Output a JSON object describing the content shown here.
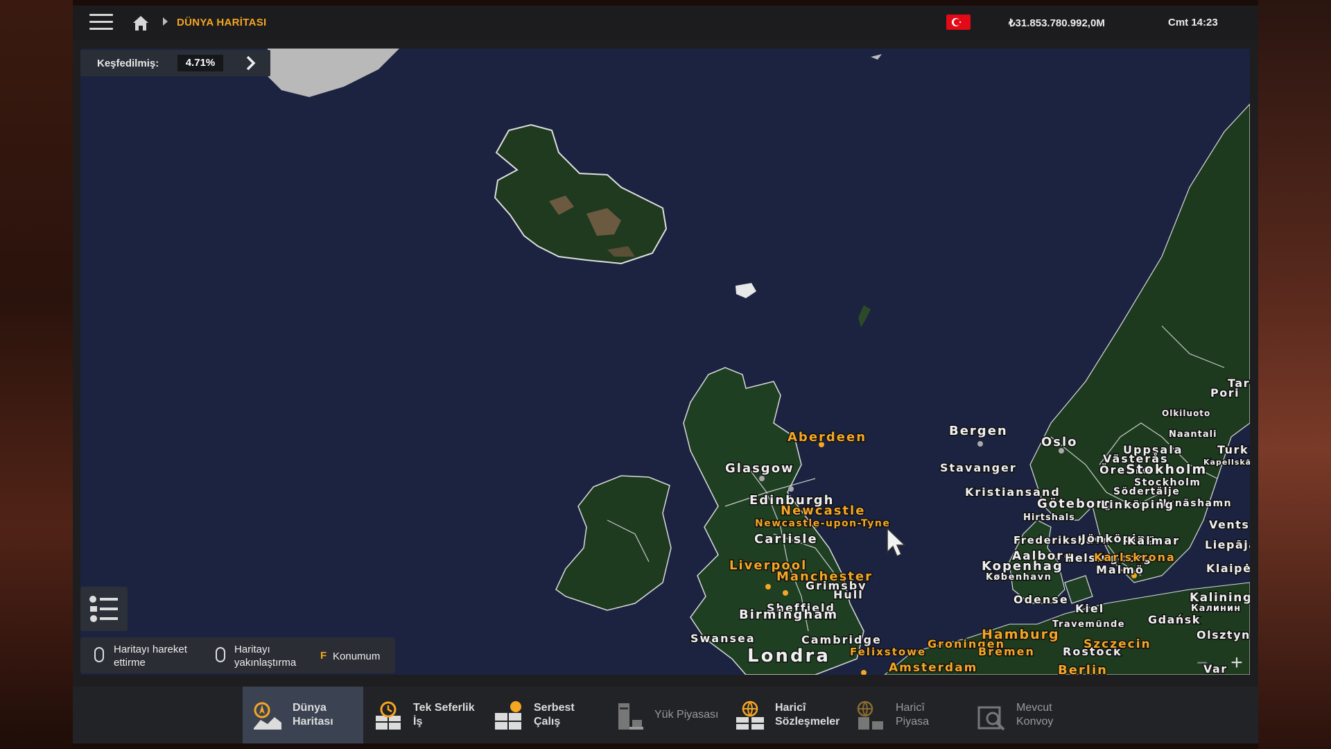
{
  "header": {
    "breadcrumb": "DÜNYA HARİTASI",
    "money": "₺31.853.780.992,0M",
    "clock": "Cmt 14:23",
    "flag": "turkey-flag-icon"
  },
  "explored": {
    "label": "Keşfedilmiş:",
    "value": "4.71%",
    "fraction": 0.0471
  },
  "map_labels": {
    "aberdeen": "Aberdeen",
    "glasgow": "Glasgow",
    "edinburgh": "Edinburgh",
    "newcastle": "Newcastle",
    "newcastle_upon_tyne": "Newcastle-upon-Tyne",
    "carlisle": "Carlisle",
    "liverpool": "Liverpool",
    "manchester": "Manchester",
    "grimsby": "Grimsby",
    "hull": "Hull",
    "sheffield": "Sheffield",
    "birmingham": "Birmingham",
    "swansea": "Swansea",
    "cambridge": "Cambridge",
    "londra": "Londra",
    "felixstowe": "Felixstowe",
    "amsterdam": "Amsterdam",
    "groningen": "Groningen",
    "bremen": "Bremen",
    "hamburg": "Hamburg",
    "rostock": "Rostock",
    "szczecin": "Szczecin",
    "berlin": "Berlin",
    "bergen": "Bergen",
    "oslo": "Oslo",
    "stavanger": "Stavanger",
    "kristiansand": "Kristiansand",
    "goteborg": "Göteborg",
    "hirtshals": "Hirtshals",
    "frederikshavn": "Frederikshavn",
    "aalborg": "Aalborg",
    "kopenhag": "Kopenhag",
    "kobenhavn": "København",
    "malmo": "Malmö",
    "helsingborg": "Helsingborg",
    "odense": "Odense",
    "travemunde": "Travemünde",
    "kiel": "Kiel",
    "uppsala": "Uppsala",
    "vasteras": "Västerås",
    "orebro": "Örebro",
    "stokholm": "Stokholm",
    "stockholm": "Stockholm",
    "sodertalje": "Södertälje",
    "nynashamn": "Nynäshamn",
    "linkoping": "Linköping",
    "jonkoping": "Jönköping",
    "kalmar": "Kalmar",
    "karlskrona": "Karlskrona",
    "olkiluoto": "Olkiluoto",
    "naantali": "Naantali",
    "kapellskar": "Kapellskär",
    "pori": "Pori",
    "tampere": "Tar",
    "turku": "Turk",
    "ventspils": "Vents",
    "liepaja": "Liepāja",
    "klaipeda": "Klaipė",
    "kaliningrad": "Kalining",
    "kaliningrad_ru": "Калинин",
    "gdansk": "Gdańsk",
    "olsztyn": "Olsztyn",
    "warszawa": "Var"
  },
  "hints": {
    "move_label": "Haritayı hareket ettirme",
    "zoom_label": "Haritayı yakınlaştırma",
    "f_key": "F",
    "location_label": "Konumum"
  },
  "zoom": {
    "minus": "−",
    "plus": "+"
  },
  "nav": [
    {
      "label1": "Dünya",
      "label2": "Haritası",
      "icon": "world-map-icon",
      "active": true
    },
    {
      "label1": "Tek Seferlik",
      "label2": "İş",
      "icon": "one-time-job-icon"
    },
    {
      "label1": "Serbest",
      "label2": "Çalış",
      "icon": "freelance-icon"
    },
    {
      "label1": "Yük Piyasası",
      "label2": "",
      "icon": "cargo-market-icon",
      "dim": true
    },
    {
      "label1": "Haricî",
      "label2": "Sözleşmeler",
      "icon": "external-contracts-icon"
    },
    {
      "label1": "Haricî",
      "label2": "Piyasa",
      "icon": "external-market-icon",
      "dim": true
    },
    {
      "label1": "Mevcut",
      "label2": "Konvoy",
      "icon": "convoy-icon",
      "dim": true
    }
  ],
  "colors": {
    "accent": "#f5a623",
    "sea": "#1b2340",
    "land": "#1f3d22",
    "nav_active": "#3b4353"
  }
}
